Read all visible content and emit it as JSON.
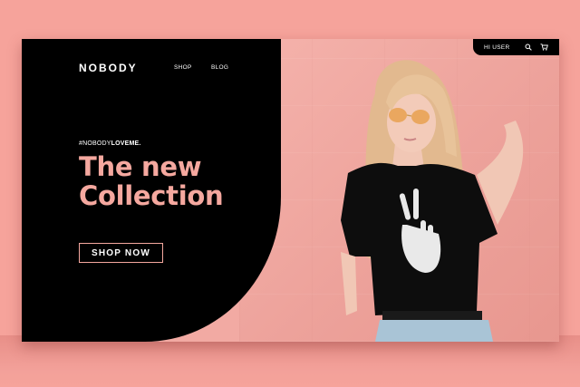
{
  "header": {
    "logo": "NOBODY",
    "nav": [
      {
        "label": "SHOP"
      },
      {
        "label": "BLOG"
      }
    ],
    "user_label": "HI  USER",
    "icons": [
      "search-icon",
      "cart-icon"
    ]
  },
  "hero": {
    "hashtag_prefix": "#NOBODY",
    "hashtag_bold": "LOVEME.",
    "headline_line1": "The new",
    "headline_line2": "Collection",
    "cta_label": "SHOP NOW"
  },
  "colors": {
    "background": "#f6a39b",
    "panel": "#000000",
    "accent": "#f5a89f"
  }
}
